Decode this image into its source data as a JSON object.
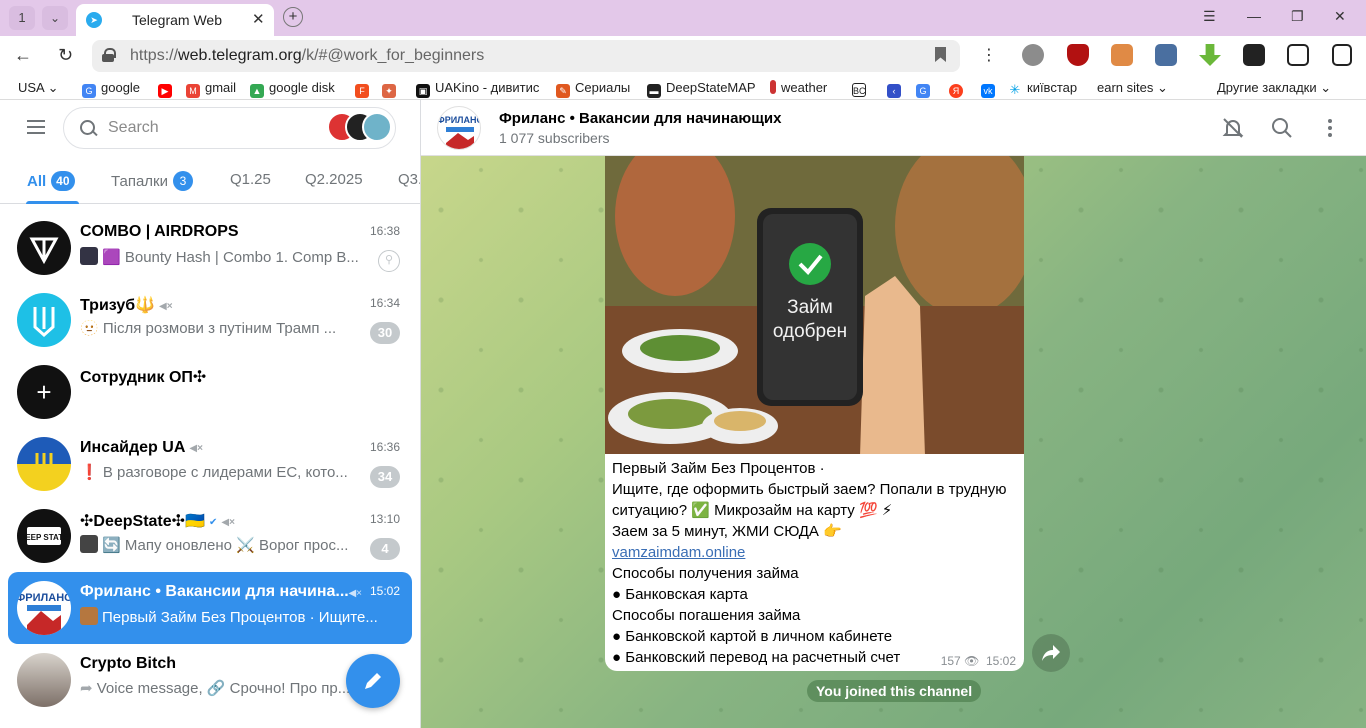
{
  "browser": {
    "tab_count": "1",
    "tab_title": "Telegram Web",
    "url_prefix": "https://",
    "url_domain": "web.telegram.org",
    "url_path": "/k/#@work_for_beginners",
    "bookmarks": [
      "USA",
      "google",
      "gmail",
      "google disk",
      "UAKino - дивитис",
      "Сериалы",
      "DeepStateMAP",
      "weather",
      "київстар",
      "earn sites",
      "Другие закладки"
    ]
  },
  "sidebar": {
    "search_placeholder": "Search",
    "folders": [
      {
        "label": "All",
        "badge": "40"
      },
      {
        "label": "Тапалки",
        "badge": "3"
      },
      {
        "label": "Q1.25"
      },
      {
        "label": "Q2.2025"
      },
      {
        "label": "Q3."
      }
    ],
    "chats": [
      {
        "title": "COMBO | AIRDROPS",
        "time": "16:38",
        "preview": "🟪 Bounty Hash | Combo 1. Comp B..."
      },
      {
        "title": "Тризуб🔱",
        "time": "16:34",
        "preview": "🫥 Після розмови з путіним Трамп ...",
        "badge": "30"
      },
      {
        "title": "Сотрудник ОП✣",
        "time": "",
        "preview": ""
      },
      {
        "title": "Инсайдер UA",
        "time": "16:36",
        "preview": "❗ В разговоре с лидерами ЕС, кото...",
        "badge": "34"
      },
      {
        "title": "✣DeepState✣🇺🇦",
        "time": "13:10",
        "preview": "🔄 Мапу оновлено ⚔️ Ворог прос...",
        "badge": "4"
      },
      {
        "title": "Фриланс • Вакансии для начина...",
        "time": "15:02",
        "preview": "Первый Займ Без Процентов · Ищите..."
      },
      {
        "title": "Crypto Bitch",
        "time": "",
        "preview": "Voice message, 🔗 Срочно! Про пр..."
      }
    ]
  },
  "channel": {
    "title": "Фриланс • Вакансии для начинающих",
    "subscribers": "1 077 subscribers"
  },
  "message": {
    "photo_caption_line1": "Займ",
    "photo_caption_line2": "одобрен",
    "line1": "Первый Займ Без Процентов ·",
    "line2": "Ищите, где оформить быстрый заем?  Попали в трудную ситуацию? ✅ Микрозайм  на карту 💯 ⚡",
    "line3": "Заем за 5 минут, ЖМИ СЮДА 👉",
    "link": "vamzaimdam.online",
    "line4": "Способы получения займа",
    "line5": "● Банковская карта",
    "line6": "Способы погашения займа",
    "line7": "● Банковской картой в личном кабинете",
    "line8": "● Банковский перевод на расчетный счет",
    "views": "157",
    "time": "15:02"
  },
  "system_message": "You joined this channel",
  "colors": {
    "accent": "#3390ec",
    "tabbar": "#e3c8e9"
  }
}
